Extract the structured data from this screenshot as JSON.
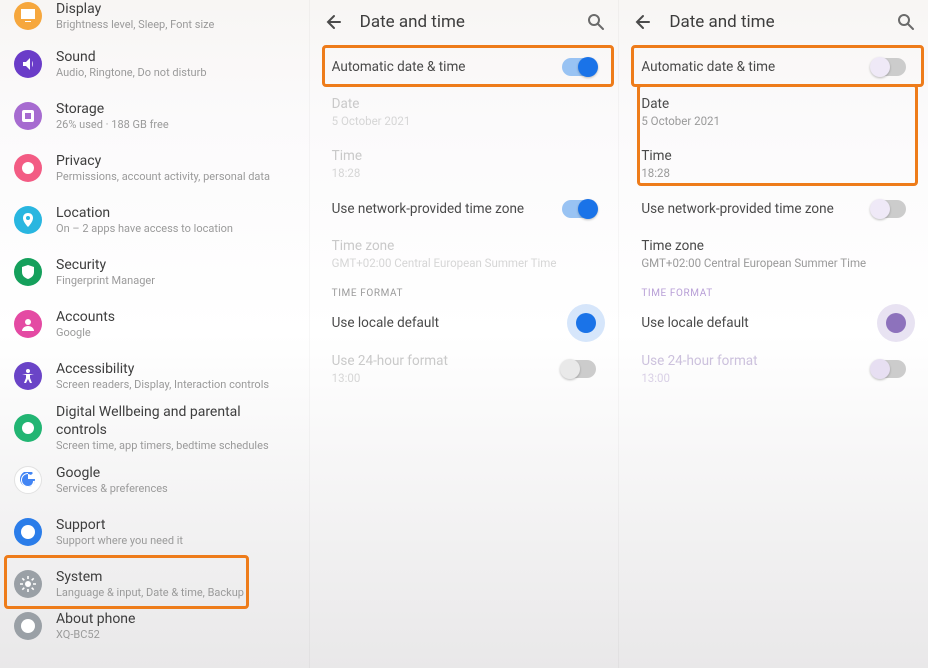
{
  "panes": {
    "settings": [
      {
        "id": "display",
        "title": "Display",
        "sub": "Brightness level, Sleep, Font size",
        "color": "c-disp",
        "icon": "display"
      },
      {
        "id": "sound",
        "title": "Sound",
        "sub": "Audio, Ringtone, Do not disturb",
        "color": "c-sound",
        "icon": "sound"
      },
      {
        "id": "storage",
        "title": "Storage",
        "sub": "26% used · 188 GB free",
        "color": "c-stor",
        "icon": "storage"
      },
      {
        "id": "privacy",
        "title": "Privacy",
        "sub": "Permissions, account activity, personal data",
        "color": "c-priv",
        "icon": "privacy"
      },
      {
        "id": "location",
        "title": "Location",
        "sub": "On – 2 apps have access to location",
        "color": "c-loc",
        "icon": "location"
      },
      {
        "id": "security",
        "title": "Security",
        "sub": "Fingerprint Manager",
        "color": "c-sec",
        "icon": "security"
      },
      {
        "id": "accounts",
        "title": "Accounts",
        "sub": "Google",
        "color": "c-acc",
        "icon": "accounts"
      },
      {
        "id": "accessibility",
        "title": "Accessibility",
        "sub": "Screen readers, Display, Interaction controls",
        "color": "c-acs",
        "icon": "accessibility"
      },
      {
        "id": "wellbeing",
        "title": "Digital Wellbeing and parental controls",
        "sub": "Screen time, app timers, bedtime schedules",
        "color": "c-dw",
        "icon": "wellbeing"
      },
      {
        "id": "google",
        "title": "Google",
        "sub": "Services & preferences",
        "color": "c-goog",
        "icon": "google"
      },
      {
        "id": "support",
        "title": "Support",
        "sub": "Support where you need it",
        "color": "c-sup",
        "icon": "support"
      },
      {
        "id": "system",
        "title": "System",
        "sub": "Language & input, Date & time, Backup",
        "color": "c-sys",
        "icon": "system"
      },
      {
        "id": "about",
        "title": "About phone",
        "sub": "XQ-BC52",
        "color": "c-abt",
        "icon": "about"
      }
    ],
    "dt": {
      "title": "Date and time",
      "auto": "Automatic date & time",
      "date_l": "Date",
      "date_v": "5 October 2021",
      "time_l": "Time",
      "time_v": "18:28",
      "net_tz": "Use network-provided time zone",
      "tz_l": "Time zone",
      "tz_v": "GMT+02:00 Central European Summer Time",
      "sec": "TIME FORMAT",
      "locale": "Use locale default",
      "h24_l": "Use 24-hour format",
      "h24_v": "13:00"
    }
  },
  "highlight": {
    "settings_item": "system",
    "dt_auto": true,
    "dt_datetime": true
  }
}
